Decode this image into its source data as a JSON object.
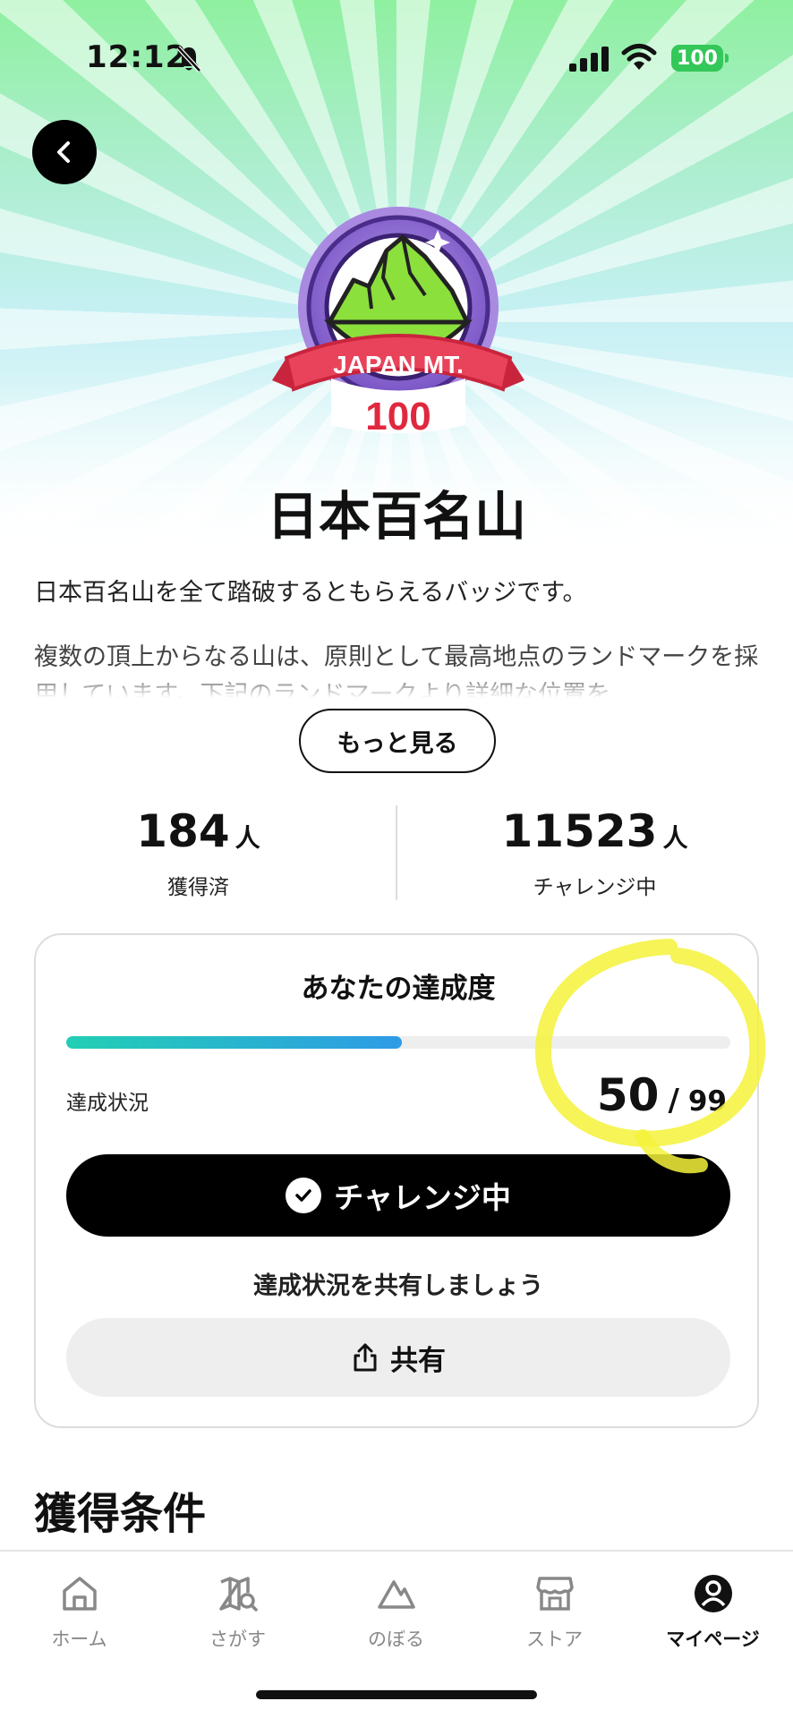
{
  "status_bar": {
    "time": "12:12",
    "battery": "100"
  },
  "badge": {
    "line1": "JAPAN MT.",
    "line2": "100"
  },
  "page": {
    "title": "日本百名山",
    "description1": "日本百名山を全て踏破するともらえるバッジです。",
    "description2": "複数の頂上からなる山は、原則として最高地点のランドマークを採用しています。下記のランドマークより詳細な位置を",
    "more_label": "もっと見る"
  },
  "stats": {
    "acquired_count": "184",
    "acquired_unit": "人",
    "acquired_label": "獲得済",
    "challenging_count": "11523",
    "challenging_unit": "人",
    "challenging_label": "チャレンジ中"
  },
  "progress_card": {
    "title": "あなたの達成度",
    "status_label": "達成状況",
    "current": "50",
    "separator": "/",
    "total": "99",
    "progress_fraction": 0.505,
    "challenge_label": "チャレンジ中",
    "share_prompt": "達成状況を共有しましょう",
    "share_label": "共有"
  },
  "conditions": {
    "title": "獲得条件"
  },
  "tabs": [
    {
      "label": "ホーム",
      "icon": "home-icon",
      "active": false
    },
    {
      "label": "さがす",
      "icon": "map-search-icon",
      "active": false
    },
    {
      "label": "のぼる",
      "icon": "mountain-icon",
      "active": false
    },
    {
      "label": "ストア",
      "icon": "store-icon",
      "active": false
    },
    {
      "label": "マイページ",
      "icon": "profile-icon",
      "active": true
    }
  ],
  "colors": {
    "progress_start": "#22cfb4",
    "progress_end": "#2e9be6",
    "battery": "#34c759",
    "highlight": "#f5f23a"
  }
}
